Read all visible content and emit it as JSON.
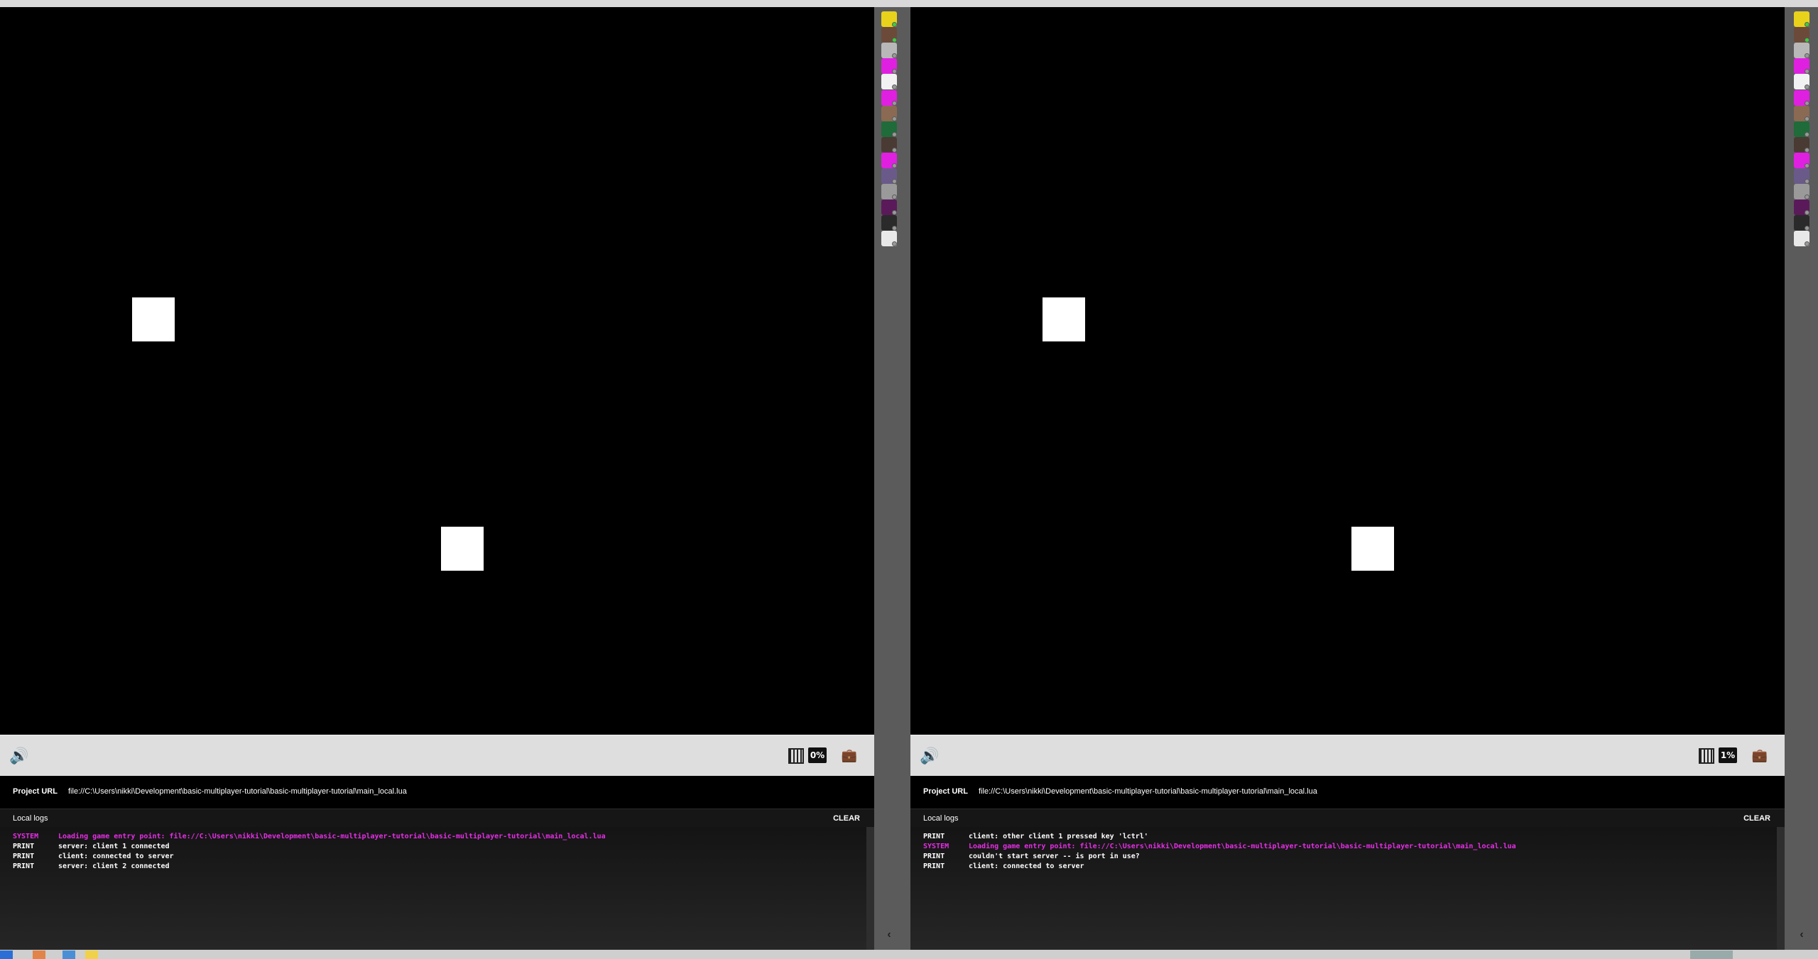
{
  "panes": [
    {
      "id": "left",
      "toolbar": {
        "volume_icon": "speaker-icon",
        "cpu_icon": "chip-icon",
        "cpu_percent": "0%",
        "tools_icon": "toolbox-icon"
      },
      "project_url": {
        "label": "Project URL",
        "value": "file://C:\\Users\\nikki\\Development\\basic-multiplayer-tutorial\\basic-multiplayer-tutorial\\main_local.lua"
      },
      "logs": {
        "title": "Local logs",
        "clear_label": "CLEAR",
        "entries": [
          {
            "level": "SYSTEM",
            "message": "Loading game entry point: file://C:\\Users\\nikki\\Development\\basic-multiplayer-tutorial\\basic-multiplayer-tutorial\\main_local.lua"
          },
          {
            "level": "PRINT",
            "message": "server: client 1 connected"
          },
          {
            "level": "PRINT",
            "message": "client: connected to server"
          },
          {
            "level": "PRINT",
            "message": "server: client 2 connected"
          }
        ]
      }
    },
    {
      "id": "right",
      "toolbar": {
        "volume_icon": "speaker-icon",
        "cpu_icon": "chip-icon",
        "cpu_percent": "1%",
        "tools_icon": "toolbox-icon"
      },
      "project_url": {
        "label": "Project URL",
        "value": "file://C:\\Users\\nikki\\Development\\basic-multiplayer-tutorial\\basic-multiplayer-tutorial\\main_local.lua"
      },
      "logs": {
        "title": "Local logs",
        "clear_label": "CLEAR",
        "entries": [
          {
            "level": "PRINT",
            "message": "client: other client 1 pressed key 'lctrl'"
          },
          {
            "level": "SYSTEM",
            "message": "Loading game entry point: file://C:\\Users\\nikki\\Development\\basic-multiplayer-tutorial\\basic-multiplayer-tutorial\\main_local.lua"
          },
          {
            "level": "PRINT",
            "message": "couldn't start server -- is port in use?"
          },
          {
            "level": "PRINT",
            "message": "client: connected to server"
          }
        ]
      }
    }
  ],
  "colors": {
    "system_log": "#e62ee6",
    "print_log": "#ffffff",
    "game_bg": "#000000",
    "player": "#ffffff"
  },
  "avatars": [
    {
      "name": "avatar-yellow",
      "color": "#e8d21c",
      "online": true
    },
    {
      "name": "avatar-photo-1",
      "color": "#6b4a3a",
      "online": true
    },
    {
      "name": "avatar-grey-sketch",
      "color": "#b8b8b8",
      "online": false
    },
    {
      "name": "avatar-magenta-1",
      "color": "#e020e0",
      "online": false
    },
    {
      "name": "avatar-logo-white",
      "color": "#f2f2f2",
      "online": false
    },
    {
      "name": "avatar-magenta-2",
      "color": "#e020e0",
      "online": false
    },
    {
      "name": "avatar-photo-2",
      "color": "#8a6a52",
      "online": false
    },
    {
      "name": "avatar-green",
      "color": "#1f6b3a",
      "online": false
    },
    {
      "name": "avatar-photo-3",
      "color": "#4a3a34",
      "online": false
    },
    {
      "name": "avatar-magenta-3",
      "color": "#e020e0",
      "online": false
    },
    {
      "name": "avatar-photo-4",
      "color": "#6a5a8a",
      "online": false
    },
    {
      "name": "avatar-grey-pattern",
      "color": "#9a9a9a",
      "online": false
    },
    {
      "name": "avatar-purple",
      "color": "#5a1a5a",
      "online": false
    },
    {
      "name": "avatar-brush",
      "color": "#2a2a2a",
      "online": false
    },
    {
      "name": "avatar-white-doodle",
      "color": "#e8e8e8",
      "online": false
    }
  ]
}
